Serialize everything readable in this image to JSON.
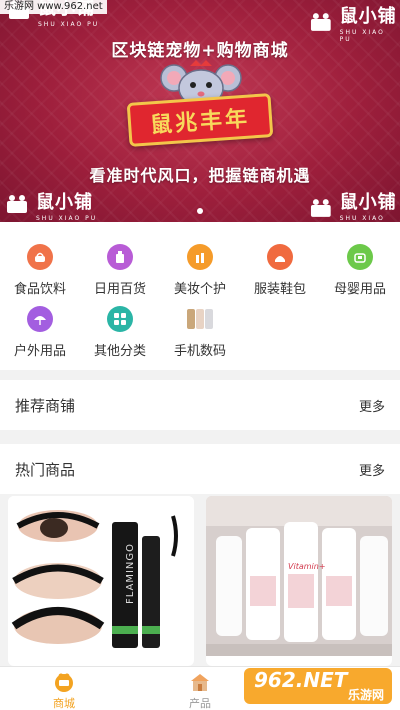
{
  "watermark": "乐游网 www.962.net",
  "banner": {
    "logo_name": "鼠小铺",
    "logo_sub": "SHU XIAO PU",
    "headline_top": "区块链宠物+购物商城",
    "sign_text": "鼠兆丰年",
    "headline_bottom": "看准时代风口，把握链商机遇",
    "carousel_dots": 1
  },
  "categories": [
    {
      "label": "食品饮料",
      "icon": "food-icon",
      "color": "#f0734a"
    },
    {
      "label": "日用百货",
      "icon": "daily-goods-icon",
      "color": "#b85cd6"
    },
    {
      "label": "美妆个护",
      "icon": "cosmetics-icon",
      "color": "#f59b2a"
    },
    {
      "label": "服装鞋包",
      "icon": "clothing-icon",
      "color": "#f06a3f"
    },
    {
      "label": "母婴用品",
      "icon": "baby-icon",
      "color": "#6cc94a"
    },
    {
      "label": "户外用品",
      "icon": "outdoor-icon",
      "color": "#a35ee0"
    },
    {
      "label": "其他分类",
      "icon": "grid-icon",
      "color": "#2bb5a6"
    },
    {
      "label": "手机数码",
      "icon": "phone-icon",
      "color": "#d9b88a"
    }
  ],
  "recommended": {
    "title": "推荐商铺",
    "more": "更多"
  },
  "hot": {
    "title": "热门商品",
    "more": "更多"
  },
  "products": [
    {
      "name": "FLAMINGO mascara",
      "text": "FLAMINGO"
    },
    {
      "name": "Vitamin E lotion",
      "text": "Vitamin+"
    }
  ],
  "tabbar": {
    "tabs": [
      {
        "label": "商城",
        "active": true,
        "color": "#f3a321"
      },
      {
        "label": "产品",
        "active": false,
        "color": "#999999"
      }
    ]
  },
  "brandmark": {
    "text": "962.NET",
    "sub": "乐游网"
  }
}
